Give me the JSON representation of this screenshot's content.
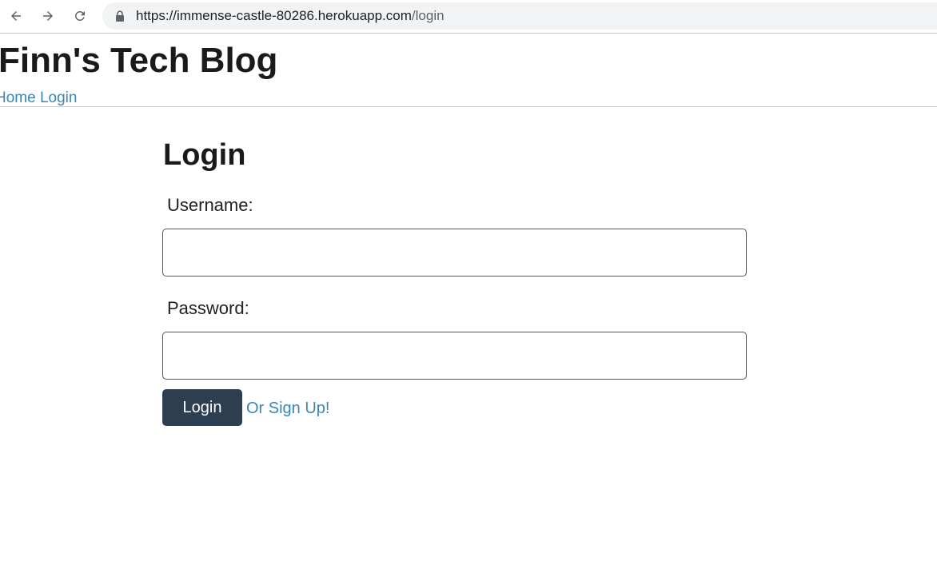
{
  "browser": {
    "url_host": "https://immense-castle-80286.herokuapp.com",
    "url_path": "/login"
  },
  "header": {
    "title": "Finn's Tech Blog",
    "nav": {
      "home": "Home",
      "login": "Login"
    }
  },
  "login_form": {
    "heading": "Login",
    "username_label": "Username:",
    "username_value": "",
    "password_label": "Password:",
    "password_value": "",
    "submit_label": "Login",
    "signup_link": "Or Sign Up!"
  },
  "icons": {
    "back": "arrow-left-icon",
    "forward": "arrow-right-icon",
    "reload": "reload-icon",
    "lock": "lock-icon"
  },
  "colors": {
    "link": "#3a86b8",
    "button_bg": "#2c3e50",
    "button_text": "#ffffff"
  }
}
